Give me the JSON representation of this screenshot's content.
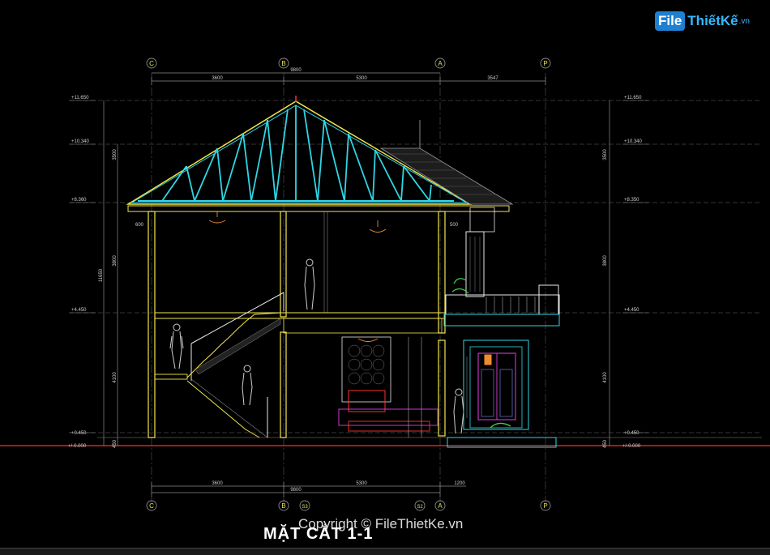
{
  "logo": {
    "brand": "File",
    "rest": "ThiếtKế",
    "tld": ".vn"
  },
  "title": "MẶT CẮT 1-1",
  "watermark": "Copyright © FileThietKe.vn",
  "grid_top": [
    "C",
    "B",
    "A",
    "P"
  ],
  "grid_bottom": [
    "C",
    "B",
    "S3",
    "S2",
    "A",
    "P"
  ],
  "dims_top": {
    "total": "9800",
    "seg1": "3600",
    "seg2": "5300",
    "seg3": "3547"
  },
  "dims_bottom": {
    "total": "9800",
    "seg1": "3600",
    "seg2": "5300",
    "seg3": "1200"
  },
  "levels": {
    "l1": "+11.650",
    "l2": "+10.340",
    "l3": "+8.360",
    "l3r": "+8.350",
    "l4": "+4.450",
    "l5": "+0.450",
    "l5r": "+0.450",
    "l6": "+/-0.000",
    "l6r": "+/-0.000"
  },
  "vdims": {
    "left": [
      "3500",
      "3800",
      "4100",
      "450"
    ],
    "left_total": "11650",
    "right": [
      "3500",
      "3800",
      "4100",
      "450"
    ]
  },
  "small_dims": {
    "eave_left": "600",
    "eave_right": "500"
  },
  "colors": {
    "cyan": "#2fd6e6",
    "yellow": "#f2e64d",
    "red": "#ff3030",
    "gray": "#8a8a8a",
    "white": "#e8e8e8",
    "green": "#40d040",
    "magenta": "#e040e0",
    "orange": "#f08a30"
  }
}
